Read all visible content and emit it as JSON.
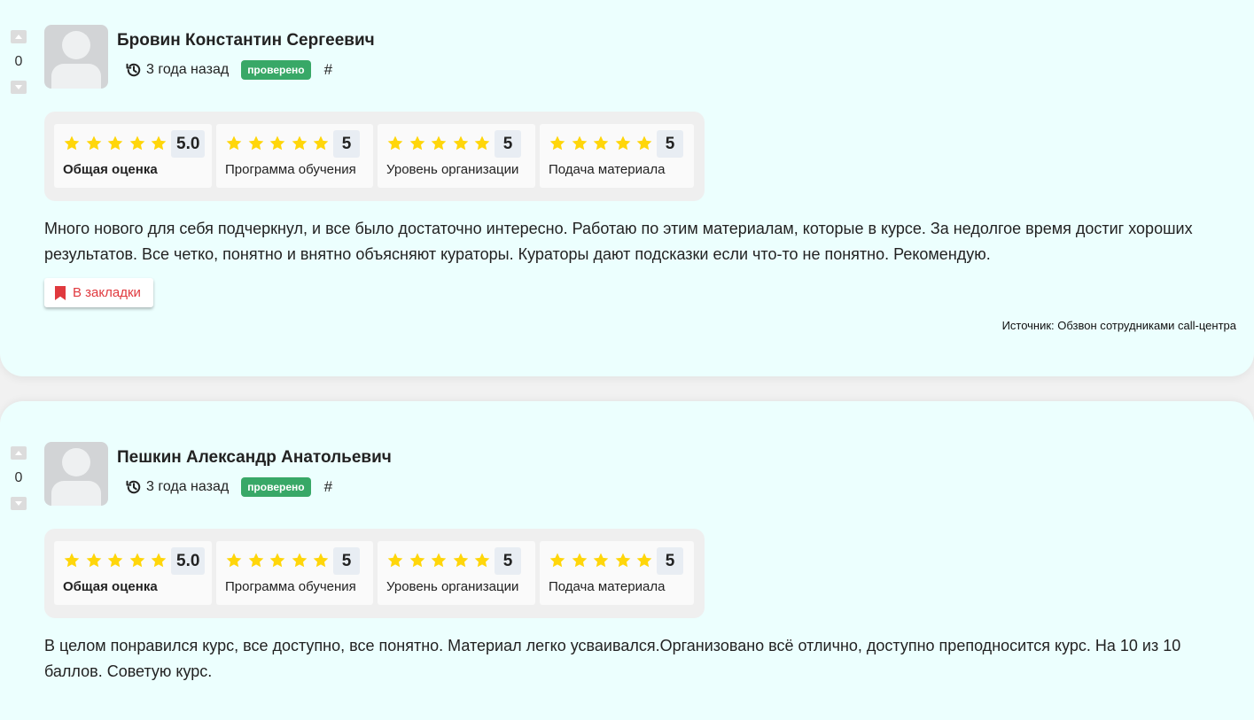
{
  "colors": {
    "card_bg": "#ecfffe",
    "page_bg": "#f1f1f1",
    "badge_green": "#38a867",
    "star_yellow": "#ffd60a",
    "bookmark_red": "#e0393e"
  },
  "icons": {
    "vote_up": "triangle-up-icon",
    "vote_down": "triangle-down-icon",
    "avatar": "user-placeholder-icon",
    "date": "history-icon",
    "star": "star-icon",
    "bookmark": "bookmark-icon"
  },
  "reviews": [
    {
      "votes": "0",
      "author": "Бровин Константин Сергеевич",
      "date": "3 года назад",
      "badge": "проверено",
      "anchor": "#",
      "ratings": [
        {
          "stars": 5,
          "score": "5.0",
          "label": "Общая оценка"
        },
        {
          "stars": 5,
          "score": "5",
          "label": "Программа обучения"
        },
        {
          "stars": 5,
          "score": "5",
          "label": "Уровень организации"
        },
        {
          "stars": 5,
          "score": "5",
          "label": "Подача материала"
        }
      ],
      "text": "Много нового для себя подчеркнул, и все было достаточно интересно. Работаю по этим материалам, которые в курсе. За недолгое время достиг хороших результатов. Все четко, понятно и внятно объясняют кураторы. Кураторы дают подсказки если что-то не понятно. Рекомендую.",
      "bookmark_label": "В закладки",
      "source": "Источник: Обзвон сотрудниками call-центра"
    },
    {
      "votes": "0",
      "author": "Пешкин Александр Анатольевич",
      "date": "3 года назад",
      "badge": "проверено",
      "anchor": "#",
      "ratings": [
        {
          "stars": 5,
          "score": "5.0",
          "label": "Общая оценка"
        },
        {
          "stars": 5,
          "score": "5",
          "label": "Программа обучения"
        },
        {
          "stars": 5,
          "score": "5",
          "label": "Уровень организации"
        },
        {
          "stars": 5,
          "score": "5",
          "label": "Подача материала"
        }
      ],
      "text": "В целом понравился курс, все доступно, все понятно. Материал легко усваивался.Организовано всё отлично, доступно преподносится курс. На 10 из 10 баллов. Советую курс."
    }
  ]
}
